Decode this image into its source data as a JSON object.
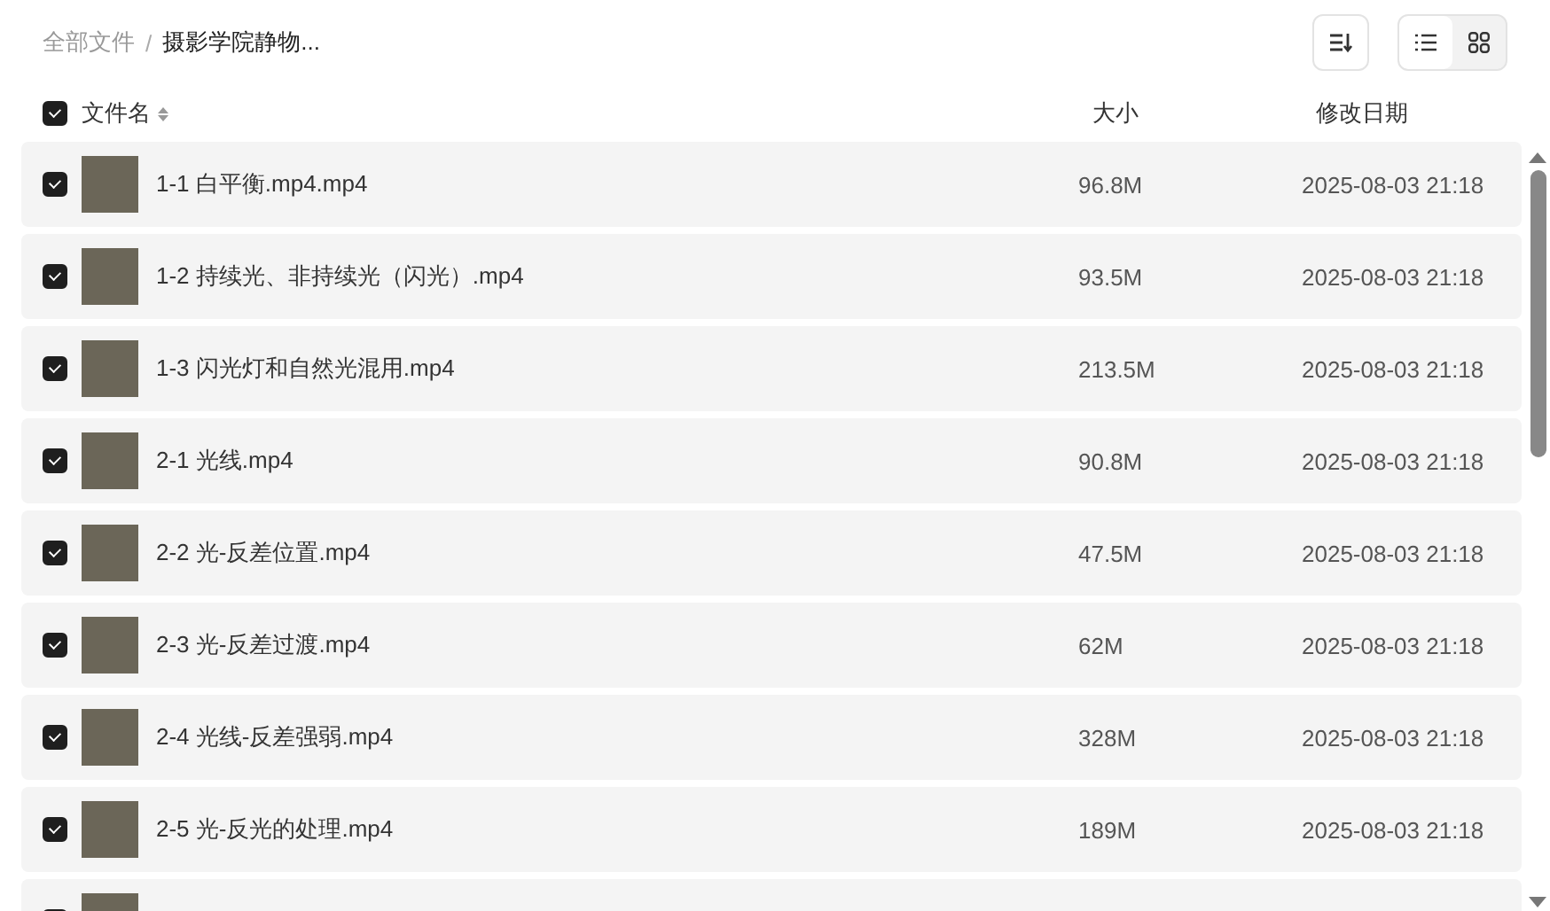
{
  "breadcrumb": {
    "separator": "/",
    "items": [
      {
        "label": "全部文件",
        "current": false
      },
      {
        "label": "摄影学院静物...",
        "current": true
      }
    ]
  },
  "toolbar": {
    "view_modes": [
      {
        "kind": "list",
        "selected": true
      },
      {
        "kind": "grid",
        "selected": false
      }
    ]
  },
  "table": {
    "select_all": {
      "checked": true
    },
    "columns": [
      "文件名",
      "大小",
      "修改日期"
    ],
    "rows": [
      {
        "checked": true,
        "name": "1-1 白平衡.mp4.mp4",
        "size": "96.8M",
        "modified": "2025-08-03 21:18"
      },
      {
        "checked": true,
        "name": "1-2 持续光、非持续光（闪光）.mp4",
        "size": "93.5M",
        "modified": "2025-08-03 21:18"
      },
      {
        "checked": true,
        "name": "1-3 闪光灯和自然光混用.mp4",
        "size": "213.5M",
        "modified": "2025-08-03 21:18"
      },
      {
        "checked": true,
        "name": "2-1 光线.mp4",
        "size": "90.8M",
        "modified": "2025-08-03 21:18"
      },
      {
        "checked": true,
        "name": "2-2 光-反差位置.mp4",
        "size": "47.5M",
        "modified": "2025-08-03 21:18"
      },
      {
        "checked": true,
        "name": "2-3 光-反差过渡.mp4",
        "size": "62M",
        "modified": "2025-08-03 21:18"
      },
      {
        "checked": true,
        "name": "2-4 光线-反差强弱.mp4",
        "size": "328M",
        "modified": "2025-08-03 21:18"
      },
      {
        "checked": true,
        "name": "2-5 光-反光的处理.mp4",
        "size": "189M",
        "modified": "2025-08-03 21:18"
      },
      {
        "checked": true
      }
    ]
  }
}
